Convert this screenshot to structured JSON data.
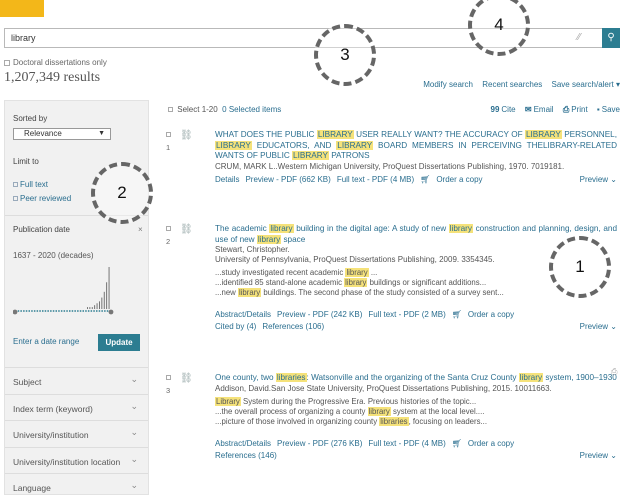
{
  "search": {
    "query": "library"
  },
  "filters_top": {
    "doctoral_only": "Doctoral dissertations only",
    "result_count": "1,207,349 results"
  },
  "top_links": {
    "modify": "Modify search",
    "recent": "Recent searches",
    "save_alert": "Save search/alert ▾"
  },
  "sidebar": {
    "sorted_by_label": "Sorted by",
    "sort_value": "Relevance",
    "limit_to_label": "Limit to",
    "full_text": "Full text",
    "peer_reviewed": "Peer reviewed",
    "pub_date_label": "Publication date",
    "pub_close": "×",
    "pub_range": "1637 - 2020 (decades)",
    "enter_date_range": "Enter a date range",
    "update": "Update",
    "facets": [
      "Subject",
      "Index term (keyword)",
      "University/institution",
      "University/institution location",
      "Language"
    ]
  },
  "results_bar": {
    "select_range": "Select 1-20",
    "selected": "0 Selected items",
    "cite_icon": "99",
    "cite": "Cite",
    "email_icon": "✉",
    "email": "Email",
    "print_icon": "⎙",
    "print": "Print",
    "save_icon": "▪",
    "save": "Save"
  },
  "results": [
    {
      "number": "1",
      "title_parts": [
        "WHAT DOES THE PUBLIC ",
        "LIBRARY",
        " USER REALLY WANT? THE ACCURACY OF ",
        "LIBRARY",
        " PERSONNEL, ",
        "LIBRARY",
        " EDUCATORS, AND ",
        "LIBRARY",
        " BOARD MEMBERS IN PERCEIVING THELIBRARY-RELATED WANTS OF PUBLIC ",
        "LIBRARY",
        " PATRONS"
      ],
      "meta": "CRUM, MARK L..Western Michigan University, ProQuest Dissertations Publishing, 1970. 7019181.",
      "links": [
        "Details",
        "Preview - PDF (662 KB)",
        "Full text - PDF (4 MB)",
        "Order a copy"
      ],
      "preview": "Preview ⌄"
    },
    {
      "number": "2",
      "title_parts": [
        "The academic ",
        "library",
        " building in the digital age: A study of new ",
        "library",
        " construction and planning, design, and use of new ",
        "library",
        " space"
      ],
      "author": "Stewart, Christopher.",
      "meta": "University of Pennsylvania, ProQuest Dissertations Publishing, 2009. 3354345.",
      "snippets": [
        [
          "...study investigated recent academic ",
          "library",
          " ..."
        ],
        [
          "...identified 85 stand-alone academic ",
          "library",
          " buildings or significant additions..."
        ],
        [
          "...new ",
          "library",
          " buildings. The second phase of the study consisted of a survey sent..."
        ]
      ],
      "links": [
        "Abstract/Details",
        "Preview - PDF (242 KB)",
        "Full text - PDF (2 MB)",
        "Order a copy"
      ],
      "cited_by": "Cited by (4)",
      "references": "References (106)",
      "preview": "Preview ⌄"
    },
    {
      "number": "3",
      "title_parts": [
        "One county, two ",
        "libraries",
        ": Watsonville and the organizing of the Santa Cruz County ",
        "library",
        " system, 1900–1930"
      ],
      "meta": "Addison, David.San Jose State University, ProQuest Dissertations Publishing, 2015. 10011663.",
      "snippets": [
        [
          "",
          "Library",
          " System during the Progressive Era. Previous histories of the topic..."
        ],
        [
          "...the overall process of organizing a county ",
          "library",
          " system at the local level...."
        ],
        [
          "...picture of those involved in organizing county ",
          "libraries",
          ", focusing on leaders..."
        ]
      ],
      "links": [
        "Abstract/Details",
        "Preview - PDF (276 KB)",
        "Full text - PDF (4 MB)",
        "Order a copy"
      ],
      "references": "References (146)",
      "preview": "Preview ⌄"
    }
  ],
  "annotations": [
    "1",
    "2",
    "3",
    "4"
  ],
  "icons": {
    "search": "search-icon",
    "order": "cart-icon",
    "doc": "document-icon"
  },
  "colors": {
    "accent": "#2c7d91",
    "link": "#2a6e8f",
    "highlight": "#f5e27a",
    "logo": "#f3b719"
  },
  "histogram": [
    0,
    0,
    0,
    0,
    0,
    0,
    0,
    0,
    0,
    0,
    0,
    0,
    0,
    0,
    0,
    0,
    0,
    0,
    0,
    0,
    0,
    0,
    0,
    0,
    0,
    0,
    0,
    0,
    0,
    0,
    1,
    1,
    1,
    2,
    3,
    4,
    6,
    9,
    14,
    22
  ]
}
